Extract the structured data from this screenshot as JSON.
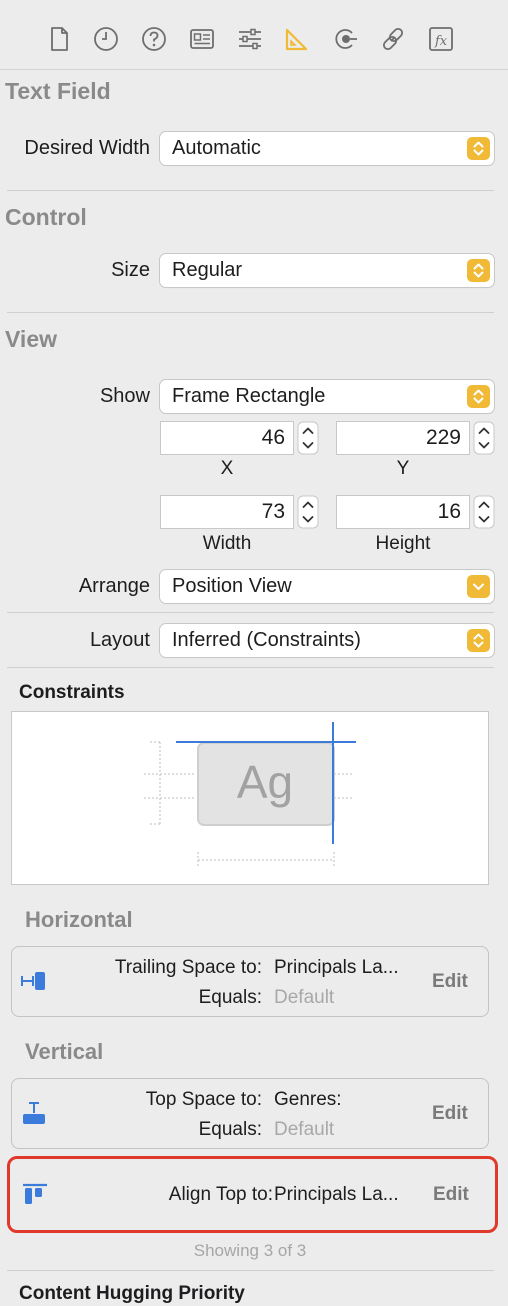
{
  "toolbar": {
    "icons": [
      "file-icon",
      "clock-icon",
      "help-icon",
      "identity-icon",
      "sliders-icon",
      "ruler-icon",
      "connections-icon",
      "link-icon",
      "fx-icon"
    ],
    "active": "ruler-icon",
    "accent": "#f0b936"
  },
  "text_field": {
    "title": "Text Field",
    "desired_width_label": "Desired Width",
    "desired_width_value": "Automatic"
  },
  "control": {
    "title": "Control",
    "size_label": "Size",
    "size_value": "Regular"
  },
  "view": {
    "title": "View",
    "show_label": "Show",
    "show_value": "Frame Rectangle",
    "x": "46",
    "x_label": "X",
    "y": "229",
    "y_label": "Y",
    "width": "73",
    "width_label": "Width",
    "height": "16",
    "height_label": "Height",
    "arrange_label": "Arrange",
    "arrange_value": "Position View",
    "layout_label": "Layout",
    "layout_value": "Inferred (Constraints)"
  },
  "constraints": {
    "title": "Constraints",
    "preview_text": "Ag",
    "horizontal_title": "Horizontal",
    "vertical_title": "Vertical",
    "horizontal": [
      {
        "line1_label": "Trailing Space to:",
        "line1_value": "Principals La...",
        "line2_label": "Equals:",
        "line2_value": "Default",
        "edit": "Edit"
      }
    ],
    "vertical": [
      {
        "line1_label": "Top Space to:",
        "line1_value": "Genres:",
        "line2_label": "Equals:",
        "line2_value": "Default",
        "edit": "Edit"
      },
      {
        "line1_label": "Align Top to:",
        "line1_value": "Principals La...",
        "edit": "Edit",
        "highlighted": true,
        "highlight_color": "#e0392b"
      }
    ],
    "showing": "Showing 3 of 3"
  },
  "content_hugging": {
    "title": "Content Hugging Priority"
  }
}
